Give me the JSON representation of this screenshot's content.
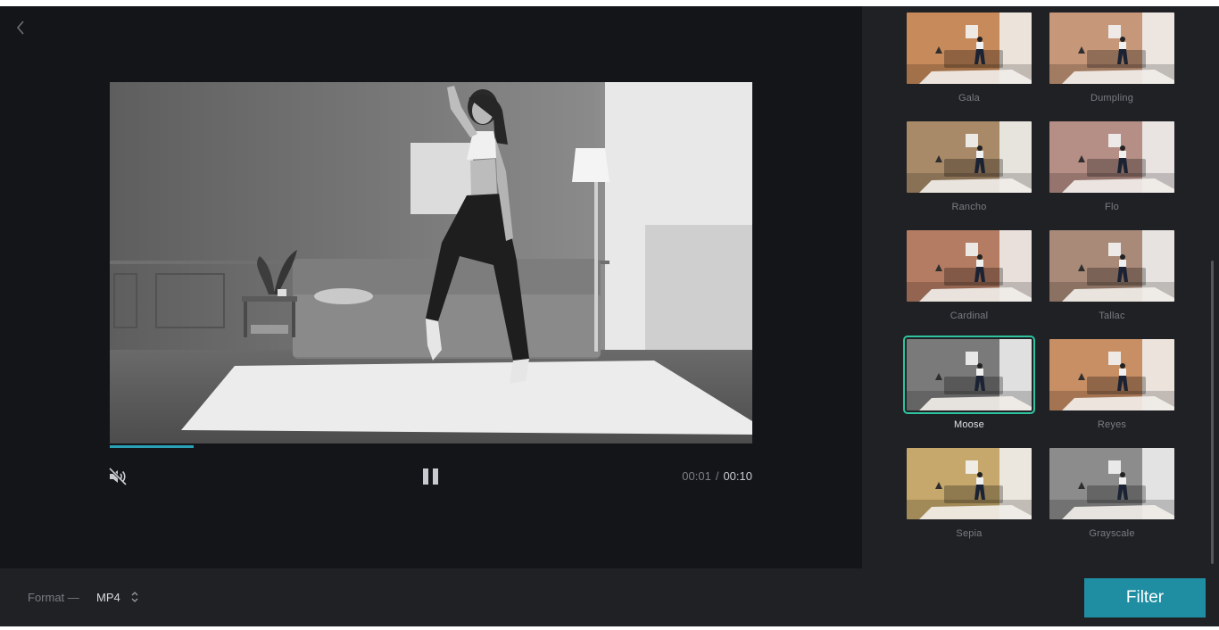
{
  "player": {
    "progress_fraction": 0.13,
    "current_time": "00:01",
    "separator": "/",
    "total_time": "00:10"
  },
  "icons": {
    "back": "chevron-left-icon",
    "mute": "volume-muted-icon",
    "pause": "pause-icon",
    "format_caret": "up-down-caret-icon"
  },
  "filters": [
    {
      "name": "Gala",
      "tint": "#c78a5a",
      "selected": false
    },
    {
      "name": "Dumpling",
      "tint": "#c69779",
      "selected": false
    },
    {
      "name": "Rancho",
      "tint": "#a88a68",
      "selected": false
    },
    {
      "name": "Flo",
      "tint": "#b58e86",
      "selected": false
    },
    {
      "name": "Cardinal",
      "tint": "#b47c62",
      "selected": false
    },
    {
      "name": "Tallac",
      "tint": "#a98a78",
      "selected": false
    },
    {
      "name": "Moose",
      "tint": "#7a7a7a",
      "selected": true
    },
    {
      "name": "Reyes",
      "tint": "#c88e64",
      "selected": false
    },
    {
      "name": "Sepia",
      "tint": "#c6a86c",
      "selected": false
    },
    {
      "name": "Grayscale",
      "tint": "#8c8c8c",
      "selected": false
    }
  ],
  "bottom": {
    "format_label": "Format —",
    "format_value": "MP4",
    "filter_button": "Filter"
  },
  "colors": {
    "accent": "#1f8ea2",
    "selected_outline": "#2ec4a0",
    "progress": "#2aa1b5"
  }
}
